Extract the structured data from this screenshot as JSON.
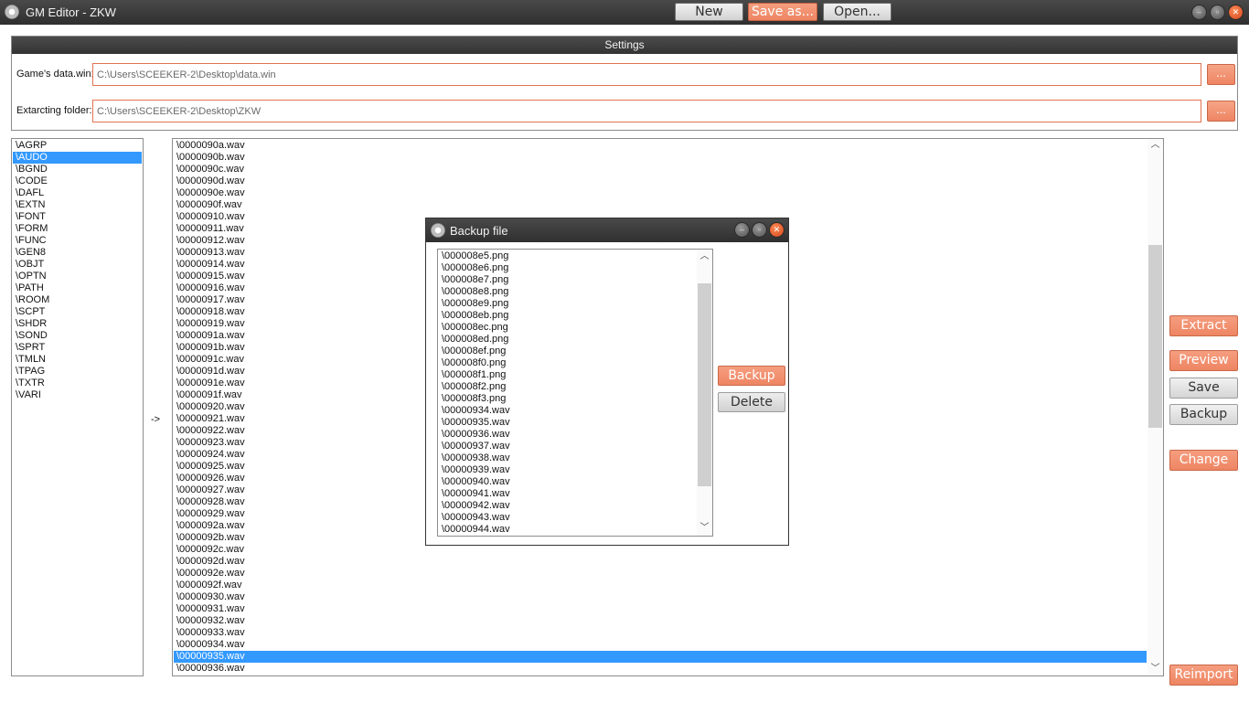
{
  "window": {
    "title": "GM Editor - ZKW",
    "buttons": {
      "new": "New",
      "save_as": "Save as...",
      "open": "Open..."
    }
  },
  "settings": {
    "header": "Settings",
    "data_win_label": "Game's data.win:",
    "data_win_value": "C:\\Users\\SCEEKER-2\\Desktop\\data.win",
    "extract_label": "Extarcting folder:",
    "extract_value": "C:\\Users\\SCEEKER-2\\Desktop\\ZKW",
    "browse_label": "..."
  },
  "categories": {
    "selected": "\\AUDO",
    "items": [
      "\\AGRP",
      "\\AUDO",
      "\\BGND",
      "\\CODE",
      "\\DAFL",
      "\\EXTN",
      "\\FONT",
      "\\FORM",
      "\\FUNC",
      "\\GEN8",
      "\\OBJT",
      "\\OPTN",
      "\\PATH",
      "\\ROOM",
      "\\SCPT",
      "\\SHDR",
      "\\SOND",
      "\\SPRT",
      "\\TMLN",
      "\\TPAG",
      "\\TXTR",
      "\\VARI"
    ]
  },
  "arrow": "->",
  "files": {
    "selected": "\\00000935.wav",
    "items": [
      "\\0000090a.wav",
      "\\0000090b.wav",
      "\\0000090c.wav",
      "\\0000090d.wav",
      "\\0000090e.wav",
      "\\0000090f.wav",
      "\\00000910.wav",
      "\\00000911.wav",
      "\\00000912.wav",
      "\\00000913.wav",
      "\\00000914.wav",
      "\\00000915.wav",
      "\\00000916.wav",
      "\\00000917.wav",
      "\\00000918.wav",
      "\\00000919.wav",
      "\\0000091a.wav",
      "\\0000091b.wav",
      "\\0000091c.wav",
      "\\0000091d.wav",
      "\\0000091e.wav",
      "\\0000091f.wav",
      "\\00000920.wav",
      "\\00000921.wav",
      "\\00000922.wav",
      "\\00000923.wav",
      "\\00000924.wav",
      "\\00000925.wav",
      "\\00000926.wav",
      "\\00000927.wav",
      "\\00000928.wav",
      "\\00000929.wav",
      "\\0000092a.wav",
      "\\0000092b.wav",
      "\\0000092c.wav",
      "\\0000092d.wav",
      "\\0000092e.wav",
      "\\0000092f.wav",
      "\\00000930.wav",
      "\\00000931.wav",
      "\\00000932.wav",
      "\\00000933.wav",
      "\\00000934.wav",
      "\\00000935.wav",
      "\\00000936.wav"
    ]
  },
  "actions": {
    "extract": "Extract",
    "preview": "Preview",
    "save": "Save",
    "backup": "Backup",
    "change": "Change",
    "reimport": "Reimport"
  },
  "dialog": {
    "title": "Backup file",
    "backup_button": "Backup",
    "delete_button": "Delete",
    "items": [
      "\\000008e5.png",
      "\\000008e6.png",
      "\\000008e7.png",
      "\\000008e8.png",
      "\\000008e9.png",
      "\\000008eb.png",
      "\\000008ec.png",
      "\\000008ed.png",
      "\\000008ef.png",
      "\\000008f0.png",
      "\\000008f1.png",
      "\\000008f2.png",
      "\\000008f3.png",
      "\\00000934.wav",
      "\\00000935.wav",
      "\\00000936.wav",
      "\\00000937.wav",
      "\\00000938.wav",
      "\\00000939.wav",
      "\\00000940.wav",
      "\\00000941.wav",
      "\\00000942.wav",
      "\\00000943.wav",
      "\\00000944.wav"
    ]
  },
  "icons": {
    "app": "gear-icon",
    "minimize": "minimize-icon",
    "maximize": "maximize-icon",
    "close": "close-icon",
    "scroll_up": "chevron-up-icon",
    "scroll_down": "chevron-down-icon"
  },
  "colors": {
    "accent_orange": "#ee8563",
    "selection_blue": "#3399ff",
    "titlebar_dark": "#3a3a3a"
  }
}
